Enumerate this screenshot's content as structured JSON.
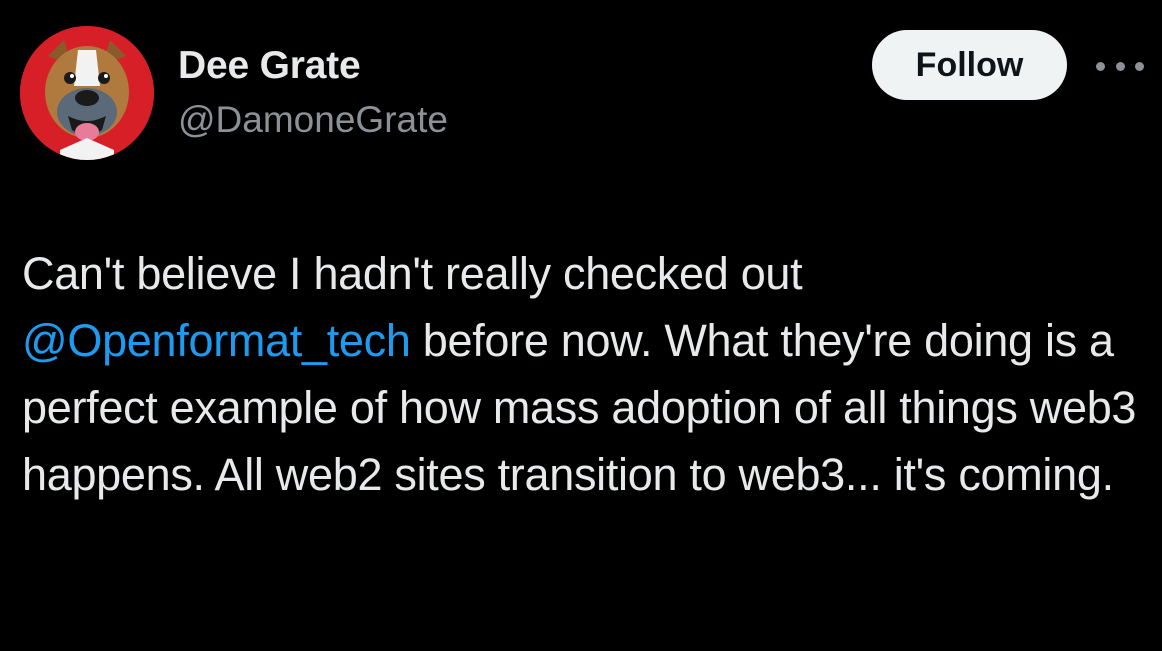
{
  "author": {
    "display_name": "Dee Grate",
    "handle": "@DamoneGrate",
    "avatar_icon": "bulldog-avatar-icon"
  },
  "actions": {
    "follow_label": "Follow",
    "more_icon": "more-options-icon"
  },
  "tweet": {
    "text_before": "Can't believe I hadn't really checked out ",
    "mention": "@Openformat_tech",
    "text_after": " before now. What they're doing is a perfect example of how mass adoption of all things web3 happens. All web2 sites transition to web3... it's coming."
  },
  "colors": {
    "background": "#000000",
    "text": "#e7e9ea",
    "secondary_text": "#8b9197",
    "mention": "#1d9bf0",
    "avatar_background": "#d61f26",
    "follow_button_bg": "#eff3f4"
  }
}
